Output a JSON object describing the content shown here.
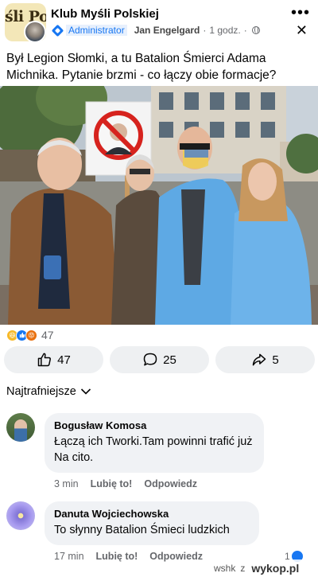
{
  "group": {
    "name": "Klub Myśli Polskiej",
    "logo_text": "śli Pol:"
  },
  "post": {
    "role": "Administrator",
    "author": "Jan Engelgard",
    "separator": "·",
    "time": "1 godz.",
    "more_icon": "more-horizontal-icon",
    "close_icon": "close-icon",
    "privacy_icon": "globe-icon",
    "text": "Był Legion Słomki, a tu Batalion Śmierci Adama Michnika. Pytanie brzmi - co łączy obie formacje?",
    "reactions": {
      "types": [
        "haha",
        "like",
        "angry"
      ],
      "count": "47"
    }
  },
  "actions": {
    "like": {
      "label": "47",
      "icon": "thumbs-up-icon"
    },
    "comment": {
      "label": "25",
      "icon": "comment-icon"
    },
    "share": {
      "label": "5",
      "icon": "share-icon"
    }
  },
  "comments_sort": {
    "label": "Najtrafniejsze",
    "icon": "chevron-down-icon"
  },
  "comments": [
    {
      "author": "Bogusław Komosa",
      "text": "Łączą ich Tworki.Tam powinni trafić już Na cito.",
      "time": "3 min",
      "like_label": "Lubię to!",
      "reply_label": "Odpowiedz"
    },
    {
      "author": "Danuta Wojciechowska",
      "text": "To słynny Batalion Śmieci ludzkich",
      "time": "17 min",
      "like_label": "Lubię to!",
      "reply_label": "Odpowiedz",
      "reaction_count": "1"
    }
  ],
  "watermark": {
    "user": "wshk",
    "letter": "z",
    "site": "wykop.pl"
  },
  "colors": {
    "accent": "#1877f2",
    "secondary_text": "#65676b",
    "button_bg": "#eef0f2",
    "bubble_bg": "#f0f2f5"
  }
}
